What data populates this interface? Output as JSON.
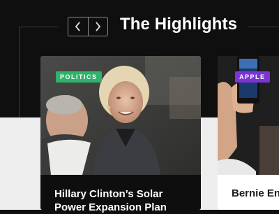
{
  "header": {
    "title": "The Highlights",
    "nav_prev_icon": "chevron-left-icon",
    "nav_next_icon": "chevron-right-icon"
  },
  "colors": {
    "background_dark": "#0f0f0f",
    "background_light": "#eeeeee",
    "politics_badge": "#2fb36a",
    "apple_badge": "#7b35d6"
  },
  "cards": [
    {
      "category": "POLITICS",
      "headline": "Hillary Clinton’s Solar Power Expansion Plan"
    },
    {
      "category": "APPLE",
      "headline": "Bernie En"
    }
  ]
}
